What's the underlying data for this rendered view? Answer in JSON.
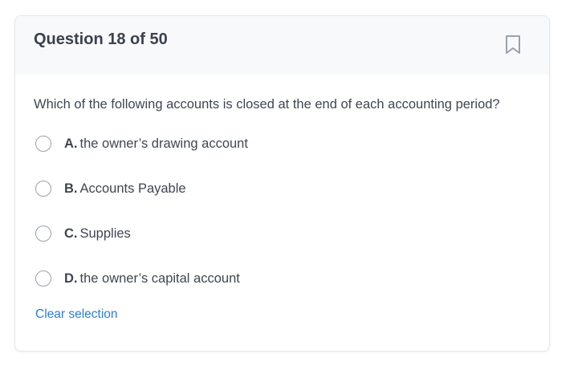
{
  "question": {
    "header": "Question 18 of 50",
    "prompt": "Which of the following accounts is closed at the end of each accounting period?",
    "options": [
      {
        "letter": "A.",
        "text": "the owner’s drawing account"
      },
      {
        "letter": "B.",
        "text": "Accounts Payable"
      },
      {
        "letter": "C.",
        "text": "Supplies"
      },
      {
        "letter": "D.",
        "text": "the owner’s capital account"
      }
    ],
    "clear_label": "Clear selection",
    "bookmark_icon": "bookmark-icon"
  },
  "colors": {
    "header_bg": "#f8f9fb",
    "link": "#2d7dd2",
    "text": "#3f4652",
    "radio_border": "#9aa1ab"
  }
}
